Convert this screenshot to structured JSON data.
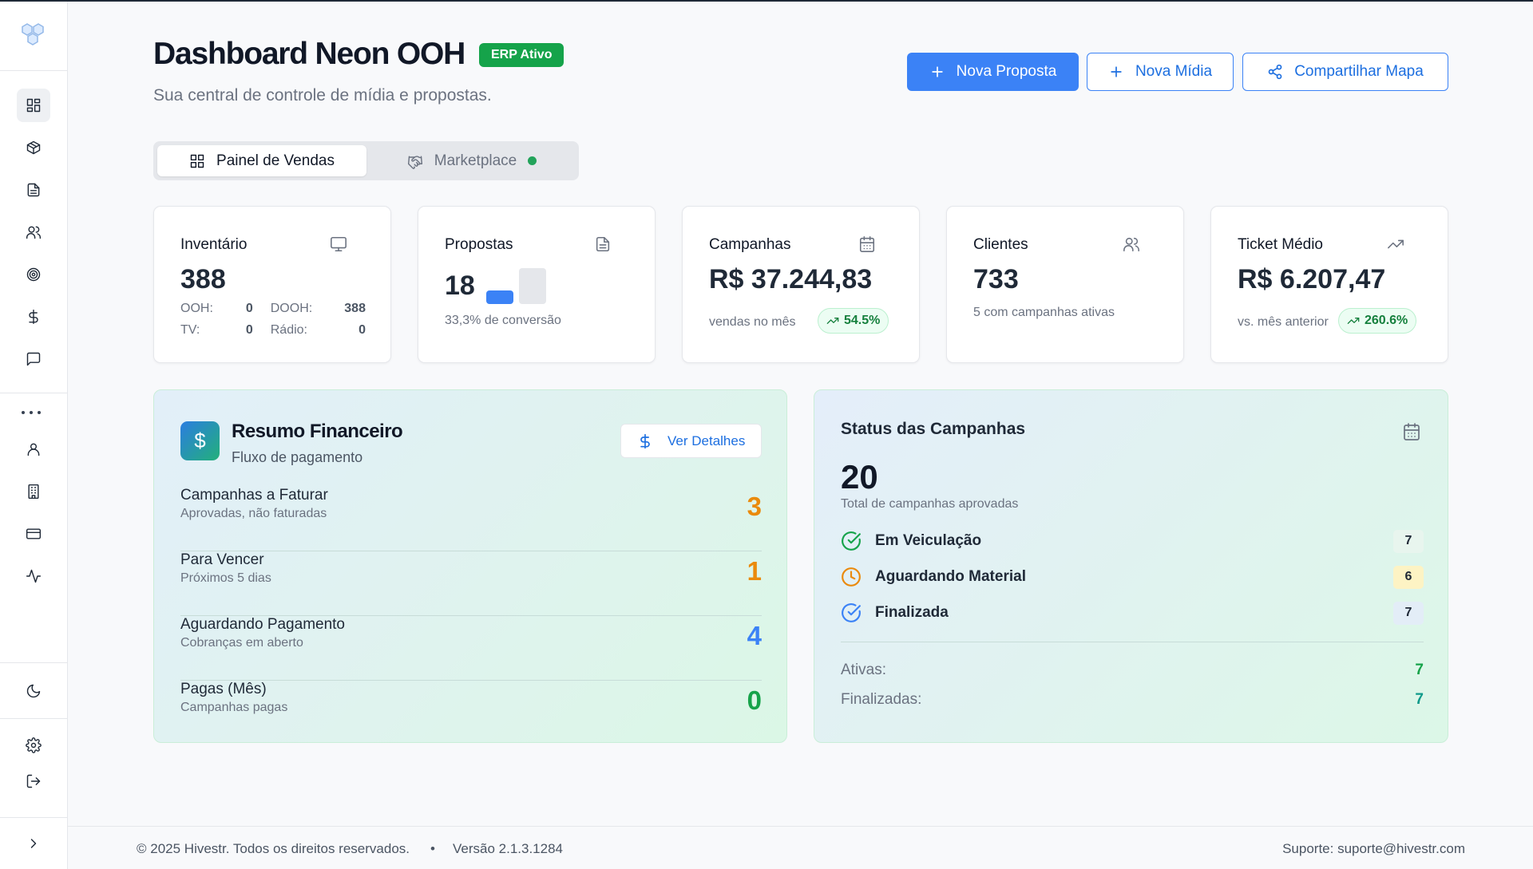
{
  "header": {
    "title": "Dashboard Neon OOH",
    "erp_badge": "ERP Ativo",
    "subtitle": "Sua central de controle de mídia e propostas.",
    "buttons": {
      "nova_proposta": "Nova Proposta",
      "nova_midia": "Nova Mídia",
      "compartilhar_mapa": "Compartilhar Mapa"
    }
  },
  "sidebar": {
    "items": [
      "dashboard-icon",
      "box-icon",
      "document-icon",
      "users-icon",
      "target-icon",
      "dollar-icon",
      "chat-icon",
      "more-icon",
      "user-icon",
      "building-icon",
      "credit-card-icon",
      "activity-icon",
      "moon-icon",
      "gear-icon",
      "logout-icon",
      "chevron-right-icon"
    ],
    "active": "dashboard-icon"
  },
  "tabs": [
    {
      "label": "Painel de Vendas",
      "active": true
    },
    {
      "label": "Marketplace",
      "active": false
    }
  ],
  "cards": {
    "inventario": {
      "title": "Inventário",
      "value": "388",
      "ooh_label": "OOH:",
      "ooh": "0",
      "dooh_label": "DOOH:",
      "dooh": "388",
      "tv_label": "TV:",
      "tv": "0",
      "radio_label": "Rádio:",
      "radio": "0"
    },
    "propostas": {
      "title": "Propostas",
      "value": "18",
      "conversion": "33,3% de conversão",
      "conversion_fraction": 0.333
    },
    "campanhas": {
      "title": "Campanhas",
      "value": "R$ 37.244,83",
      "sub": "vendas no mês",
      "trend": "54.5%"
    },
    "clientes": {
      "title": "Clientes",
      "value": "733",
      "sub": "5 com campanhas ativas"
    },
    "ticket": {
      "title": "Ticket Médio",
      "value": "R$ 6.207,47",
      "sub": "vs. mês anterior",
      "trend": "260.6%"
    }
  },
  "financeiro": {
    "title": "Resumo Financeiro",
    "subtitle": "Fluxo de pagamento",
    "details_button": "Ver Detalhes",
    "rows": [
      {
        "label": "Campanhas a Faturar",
        "desc": "Aprovadas, não faturadas",
        "value": "3",
        "color": "#ea8a0c"
      },
      {
        "label": "Para Vencer",
        "desc": "Próximos 5 dias",
        "value": "1",
        "color": "#ea8a0c"
      },
      {
        "label": "Aguardando Pagamento",
        "desc": "Cobranças em aberto",
        "value": "4",
        "color": "#3b82f6"
      },
      {
        "label": "Pagas (Mês)",
        "desc": "Campanhas pagas",
        "value": "0",
        "color": "#16a34a"
      }
    ]
  },
  "status": {
    "title": "Status das Campanhas",
    "total": "20",
    "total_desc": "Total de campanhas aprovadas",
    "rows": [
      {
        "label": "Em Veiculação",
        "count": "7",
        "icon": "check-circle-icon",
        "color": "#16a34a"
      },
      {
        "label": "Aguardando Material",
        "count": "6",
        "icon": "clock-icon",
        "color": "#ea8a0c"
      },
      {
        "label": "Finalizada",
        "count": "7",
        "icon": "check-circle-icon",
        "color": "#3b82f6"
      }
    ],
    "ativas_label": "Ativas:",
    "ativas": "7",
    "finalizadas_label": "Finalizadas:",
    "finalizadas": "7"
  },
  "footer": {
    "copyright": "© 2025 Hivestr. Todos os direitos reservados.",
    "separator": "•",
    "version": "Versão 2.1.3.1284",
    "support": "Suporte: suporte@hivestr.com"
  },
  "colors": {
    "primary": "#3b82f6",
    "success": "#16a34a",
    "warning": "#ea8a0c"
  }
}
